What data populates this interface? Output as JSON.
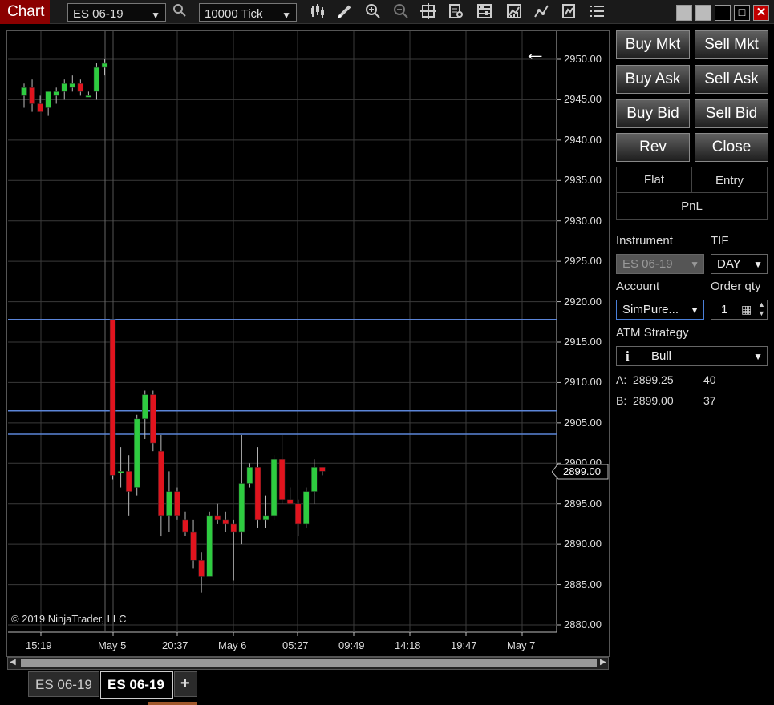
{
  "toolbar": {
    "title": "Chart",
    "instrument": "ES 06-19",
    "interval": "10000 Tick",
    "icons": [
      "bar-type-icon",
      "draw-pencil-icon",
      "zoom-in-icon",
      "zoom-out-icon",
      "crosshair-icon",
      "data-box-icon",
      "chart-properties-icon",
      "indicators-icon",
      "strategies-icon",
      "templates-icon",
      "menu-list-icon"
    ],
    "window_buttons": [
      "restore-icon",
      "minimize-icon",
      "maximize-icon",
      "close-icon"
    ]
  },
  "chart": {
    "copyright": "© 2019 NinjaTrader, LLC",
    "price_ticks": [
      "2950.00",
      "2945.00",
      "2940.00",
      "2935.00",
      "2930.00",
      "2925.00",
      "2920.00",
      "2915.00",
      "2910.00",
      "2905.00",
      "2900.00",
      "2895.00",
      "2890.00",
      "2885.00",
      "2880.00"
    ],
    "time_ticks": [
      "15:19",
      "May 5",
      "20:37",
      "May 6",
      "05:27",
      "09:49",
      "14:18",
      "19:47",
      "May 7"
    ],
    "last_price": "2899.00",
    "horizontal_lines": [
      2917.8,
      2906.5,
      2903.6
    ],
    "line_color": "#5b85d8",
    "up_color": "#2ecc40",
    "down_color": "#e0141e",
    "back_arrow": "←"
  },
  "chart_data": {
    "type": "candlestick",
    "ylim": [
      2878,
      2952
    ],
    "candles": [
      {
        "o": 2945.5,
        "h": 2947,
        "l": 2944,
        "c": 2946.5
      },
      {
        "o": 2946.5,
        "h": 2947.5,
        "l": 2943.5,
        "c": 2944.5
      },
      {
        "o": 2944.5,
        "h": 2945.5,
        "l": 2943.5,
        "c": 2943.5
      },
      {
        "o": 2944,
        "h": 2946,
        "l": 2943,
        "c": 2946
      },
      {
        "o": 2945.5,
        "h": 2946.5,
        "l": 2944.5,
        "c": 2946
      },
      {
        "o": 2946,
        "h": 2947.5,
        "l": 2945,
        "c": 2947
      },
      {
        "o": 2946.5,
        "h": 2948,
        "l": 2946,
        "c": 2947
      },
      {
        "o": 2947,
        "h": 2947.5,
        "l": 2945.5,
        "c": 2946
      },
      {
        "o": 2945.5,
        "h": 2946,
        "l": 2945.5,
        "c": 2945.5
      },
      {
        "o": 2946,
        "h": 2949.5,
        "l": 2945,
        "c": 2949
      },
      {
        "o": 2949,
        "h": 2950,
        "l": 2948,
        "c": 2949.5
      },
      {
        "o": 2917.8,
        "h": 2917.8,
        "l": 2898,
        "c": 2898.5
      },
      {
        "o": 2899,
        "h": 2902,
        "l": 2897,
        "c": 2899
      },
      {
        "o": 2899,
        "h": 2901,
        "l": 2893.5,
        "c": 2896.5
      },
      {
        "o": 2897,
        "h": 2906,
        "l": 2896,
        "c": 2905.5
      },
      {
        "o": 2905.5,
        "h": 2909,
        "l": 2903,
        "c": 2908.5
      },
      {
        "o": 2908.5,
        "h": 2909,
        "l": 2901.5,
        "c": 2902.5
      },
      {
        "o": 2901.5,
        "h": 2903.5,
        "l": 2891,
        "c": 2893.5
      },
      {
        "o": 2893.5,
        "h": 2899,
        "l": 2891.5,
        "c": 2896.5
      },
      {
        "o": 2896.5,
        "h": 2897,
        "l": 2893,
        "c": 2893.5
      },
      {
        "o": 2893,
        "h": 2894,
        "l": 2891,
        "c": 2891.5
      },
      {
        "o": 2891.5,
        "h": 2893,
        "l": 2887,
        "c": 2888
      },
      {
        "o": 2888,
        "h": 2889,
        "l": 2884,
        "c": 2886
      },
      {
        "o": 2886,
        "h": 2894,
        "l": 2886,
        "c": 2893.5
      },
      {
        "o": 2893.5,
        "h": 2895,
        "l": 2892.5,
        "c": 2893
      },
      {
        "o": 2893,
        "h": 2894,
        "l": 2891.5,
        "c": 2892.5
      },
      {
        "o": 2892.5,
        "h": 2893,
        "l": 2885.5,
        "c": 2891.5
      },
      {
        "o": 2891.5,
        "h": 2903.5,
        "l": 2890,
        "c": 2897.5
      },
      {
        "o": 2897.5,
        "h": 2900,
        "l": 2897,
        "c": 2899.5
      },
      {
        "o": 2899.5,
        "h": 2902,
        "l": 2892,
        "c": 2893
      },
      {
        "o": 2893,
        "h": 2896,
        "l": 2892,
        "c": 2893.5
      },
      {
        "o": 2893.5,
        "h": 2901,
        "l": 2893,
        "c": 2900.5
      },
      {
        "o": 2900.5,
        "h": 2903.5,
        "l": 2895,
        "c": 2895.5
      },
      {
        "o": 2895.5,
        "h": 2897,
        "l": 2895,
        "c": 2895
      },
      {
        "o": 2895,
        "h": 2895.5,
        "l": 2891,
        "c": 2892.5
      },
      {
        "o": 2892.5,
        "h": 2897,
        "l": 2892,
        "c": 2896.5
      },
      {
        "o": 2896.5,
        "h": 2900.5,
        "l": 2895,
        "c": 2899.5
      },
      {
        "o": 2899.5,
        "h": 2899.5,
        "l": 2898.5,
        "c": 2899
      }
    ]
  },
  "order_panel": {
    "buttons": [
      "Buy Mkt",
      "Sell Mkt",
      "Buy Ask",
      "Sell Ask",
      "Buy Bid",
      "Sell Bid",
      "Rev",
      "Close"
    ],
    "pnl": {
      "flat": "Flat",
      "entry": "Entry",
      "pnl": "PnL"
    },
    "instrument_label": "Instrument",
    "tif_label": "TIF",
    "instrument_value": "ES 06-19",
    "tif_value": "DAY",
    "account_label": "Account",
    "order_qty_label": "Order qty",
    "account_value": "SimPure...",
    "order_qty_value": "1",
    "atm_label": "ATM Strategy",
    "atm_value": "Bull",
    "ask_label": "A:",
    "ask_price": "2899.25",
    "ask_size": "40",
    "bid_label": "B:",
    "bid_price": "2899.00",
    "bid_size": "37"
  },
  "tabs": [
    {
      "label": "ES 06-19",
      "active": false
    },
    {
      "label": "ES 06-19",
      "active": true
    }
  ],
  "add_tab": "+"
}
